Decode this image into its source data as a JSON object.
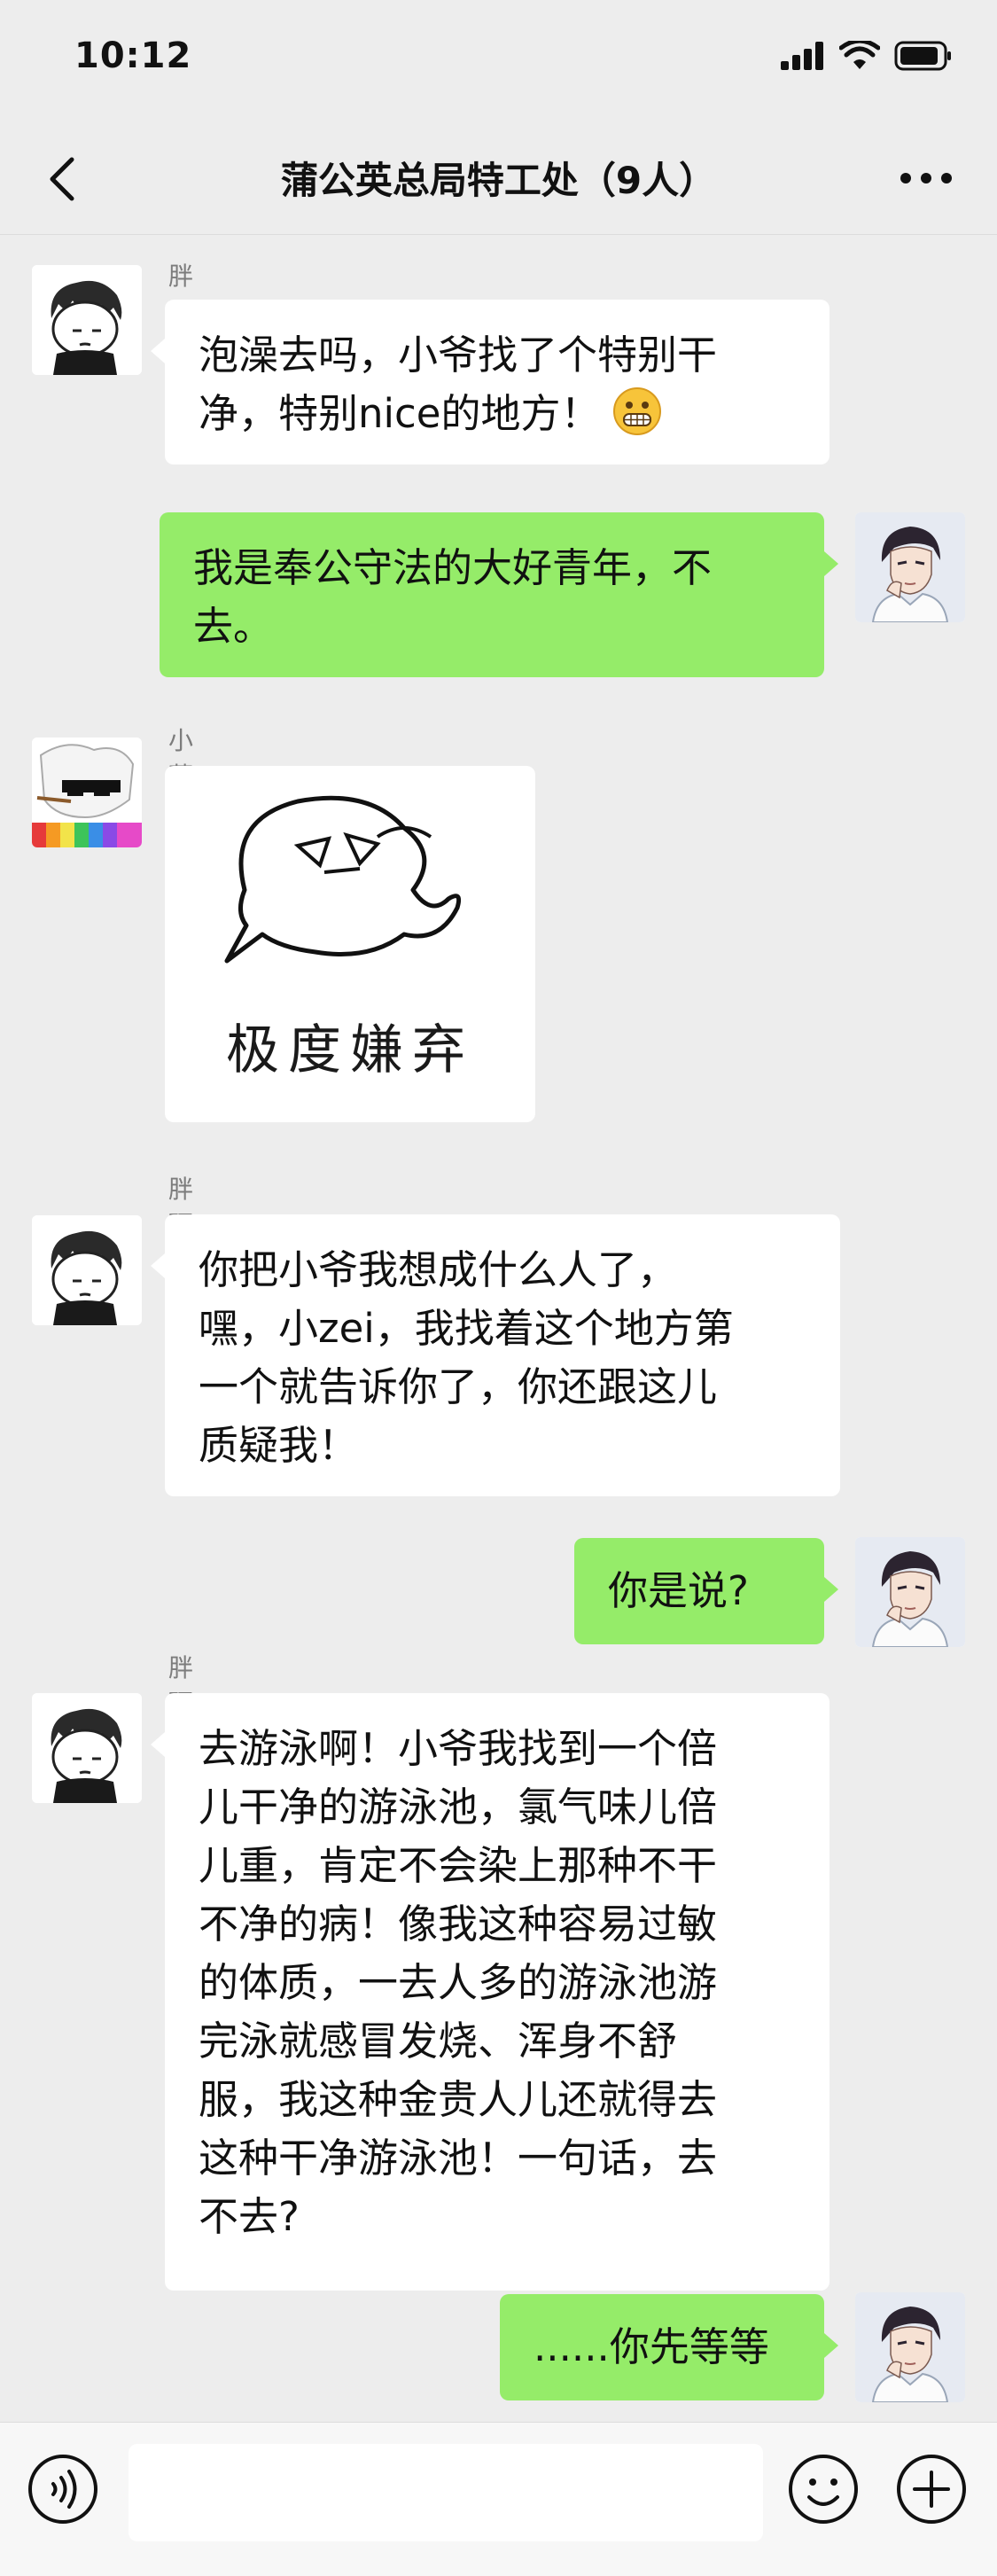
{
  "status_bar": {
    "time": "10:12"
  },
  "nav": {
    "title": "蒲公英总局特工处（9人）"
  },
  "colors": {
    "self_bubble": "#95ec69",
    "other_bubble": "#ffffff",
    "background": "#ededed"
  },
  "messages": [
    {
      "sender": "胖砸",
      "text_lines": [
        "泡澡去吗，小爷找了个特别干",
        "净，特别nice的地方！"
      ],
      "emoji": "grimace-emoji"
    },
    {
      "sender": "me",
      "text_lines": [
        "我是奉公守法的大好青年，不",
        "去。"
      ]
    },
    {
      "sender": "小蒲姐的助理",
      "sticker_caption": "极度嫌弃"
    },
    {
      "sender": "胖砸",
      "text_lines": [
        "你把小爷我想成什么人了，",
        "嘿，小zei，我找着这个地方第",
        "一个就告诉你了，你还跟这儿",
        "质疑我！"
      ]
    },
    {
      "sender": "me",
      "text_lines": [
        "你是说?"
      ]
    },
    {
      "sender": "胖砸",
      "text_lines": [
        "去游泳啊！小爷我找到一个倍",
        "儿干净的游泳池，氯气味儿倍",
        "儿重，肯定不会染上那种不干",
        "不净的病！像我这种容易过敏",
        "的体质，一去人多的游泳池游",
        "完泳就感冒发烧、浑身不舒",
        "服，我这种金贵人儿还就得去",
        "这种干净游泳池！一句话，去",
        "不去?"
      ]
    },
    {
      "sender": "me",
      "text_lines": [
        "......你先等等"
      ]
    }
  ],
  "input": {
    "placeholder": ""
  }
}
